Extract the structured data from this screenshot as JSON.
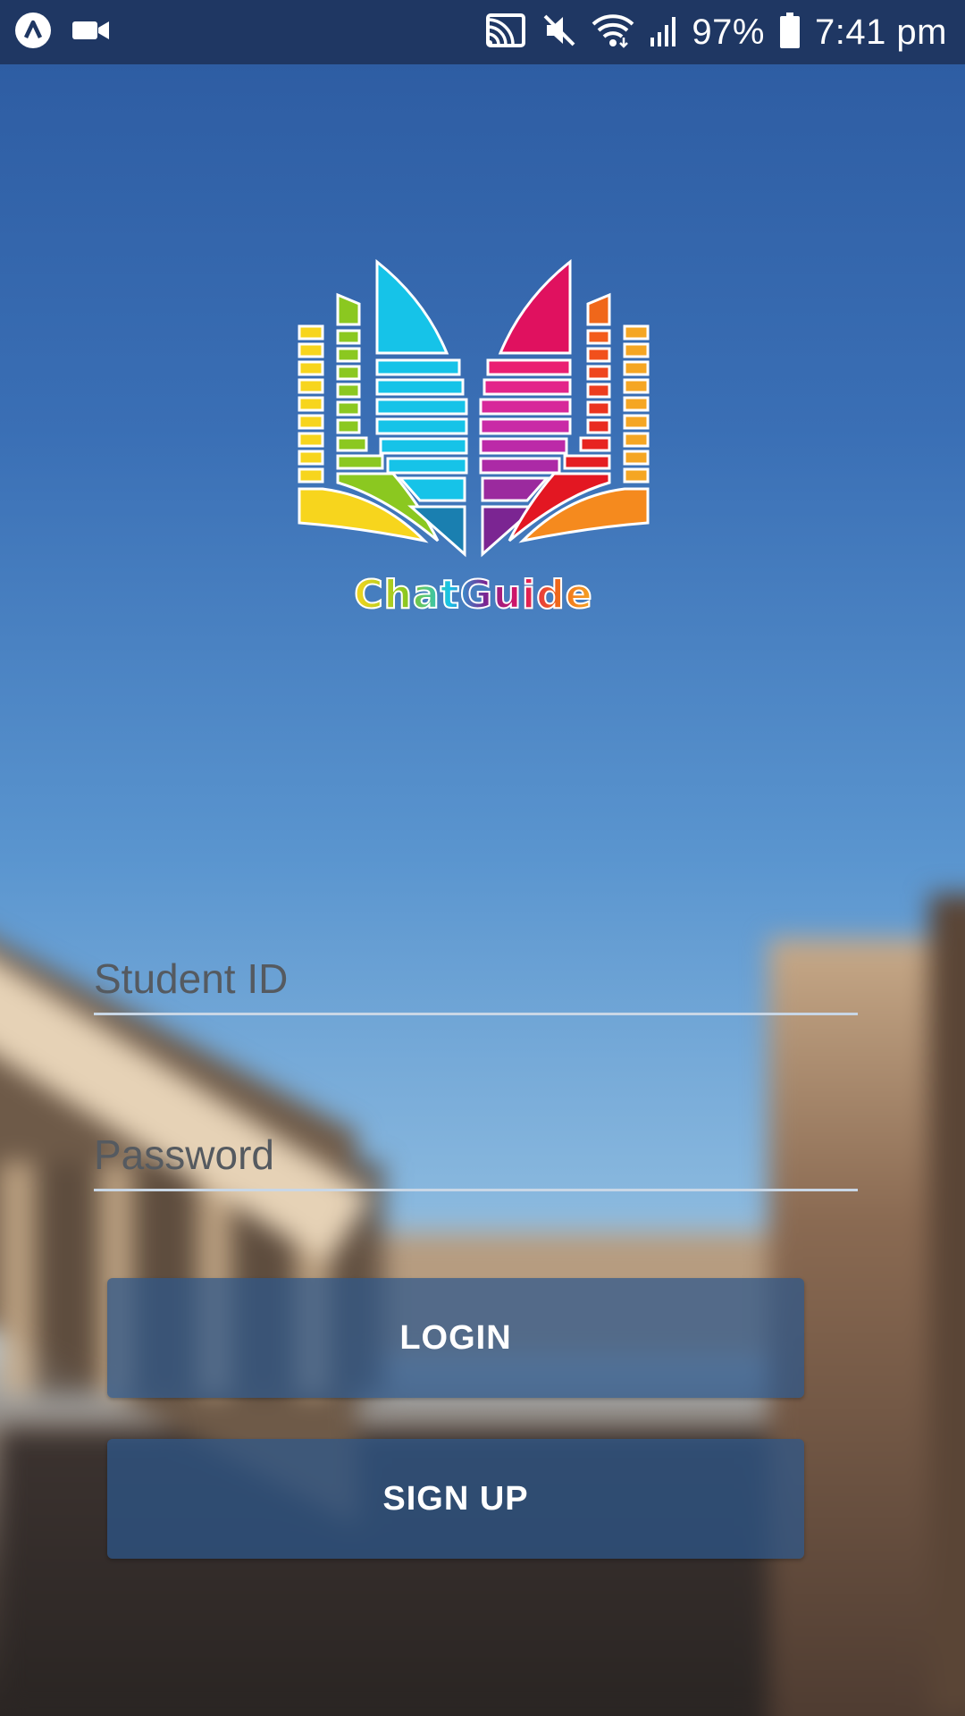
{
  "status_bar": {
    "battery_percent": "97%",
    "time": "7:41 pm",
    "icons": [
      "app-notification-icon",
      "video-camera-icon",
      "cast-icon",
      "mute-icon",
      "wifi-icon",
      "signal-icon",
      "battery-icon"
    ]
  },
  "app": {
    "logo_text": "ChatGuide",
    "logo_colors": [
      "#f7d51d",
      "#8bc820",
      "#16c3e8",
      "#e0115f",
      "#f0671a",
      "#f5a623"
    ]
  },
  "form": {
    "student_id_placeholder": "Student ID",
    "password_placeholder": "Password"
  },
  "buttons": {
    "login_label": "LOGIN",
    "signup_label": "SIGN UP"
  }
}
